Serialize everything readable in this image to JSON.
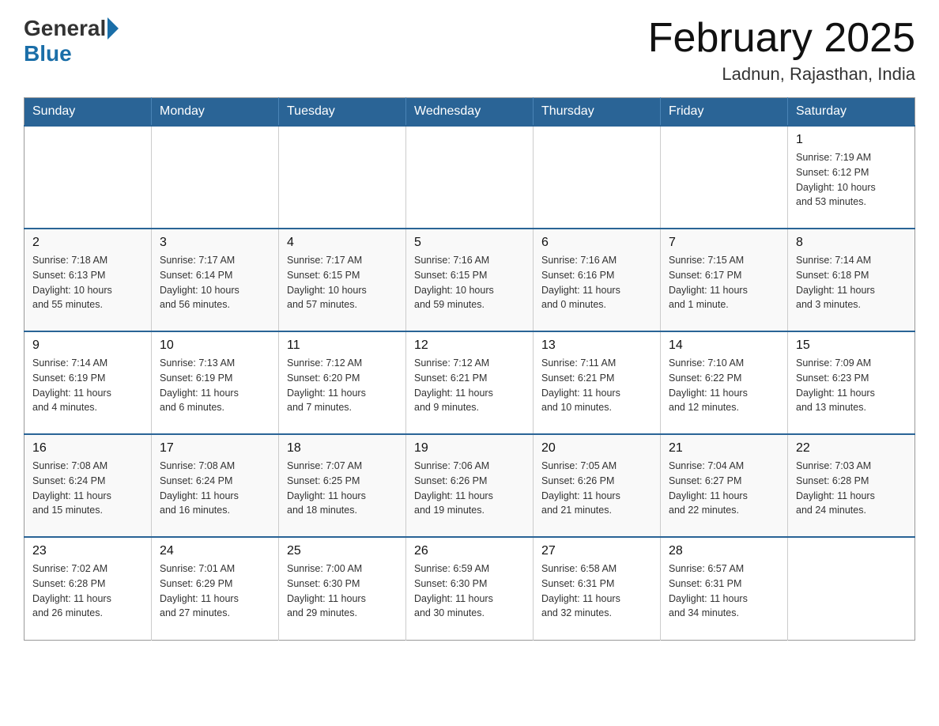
{
  "header": {
    "logo_general": "General",
    "logo_blue": "Blue",
    "month_title": "February 2025",
    "location": "Ladnun, Rajasthan, India"
  },
  "weekdays": [
    "Sunday",
    "Monday",
    "Tuesday",
    "Wednesday",
    "Thursday",
    "Friday",
    "Saturday"
  ],
  "weeks": [
    [
      {
        "day": "",
        "info": ""
      },
      {
        "day": "",
        "info": ""
      },
      {
        "day": "",
        "info": ""
      },
      {
        "day": "",
        "info": ""
      },
      {
        "day": "",
        "info": ""
      },
      {
        "day": "",
        "info": ""
      },
      {
        "day": "1",
        "info": "Sunrise: 7:19 AM\nSunset: 6:12 PM\nDaylight: 10 hours\nand 53 minutes."
      }
    ],
    [
      {
        "day": "2",
        "info": "Sunrise: 7:18 AM\nSunset: 6:13 PM\nDaylight: 10 hours\nand 55 minutes."
      },
      {
        "day": "3",
        "info": "Sunrise: 7:17 AM\nSunset: 6:14 PM\nDaylight: 10 hours\nand 56 minutes."
      },
      {
        "day": "4",
        "info": "Sunrise: 7:17 AM\nSunset: 6:15 PM\nDaylight: 10 hours\nand 57 minutes."
      },
      {
        "day": "5",
        "info": "Sunrise: 7:16 AM\nSunset: 6:15 PM\nDaylight: 10 hours\nand 59 minutes."
      },
      {
        "day": "6",
        "info": "Sunrise: 7:16 AM\nSunset: 6:16 PM\nDaylight: 11 hours\nand 0 minutes."
      },
      {
        "day": "7",
        "info": "Sunrise: 7:15 AM\nSunset: 6:17 PM\nDaylight: 11 hours\nand 1 minute."
      },
      {
        "day": "8",
        "info": "Sunrise: 7:14 AM\nSunset: 6:18 PM\nDaylight: 11 hours\nand 3 minutes."
      }
    ],
    [
      {
        "day": "9",
        "info": "Sunrise: 7:14 AM\nSunset: 6:19 PM\nDaylight: 11 hours\nand 4 minutes."
      },
      {
        "day": "10",
        "info": "Sunrise: 7:13 AM\nSunset: 6:19 PM\nDaylight: 11 hours\nand 6 minutes."
      },
      {
        "day": "11",
        "info": "Sunrise: 7:12 AM\nSunset: 6:20 PM\nDaylight: 11 hours\nand 7 minutes."
      },
      {
        "day": "12",
        "info": "Sunrise: 7:12 AM\nSunset: 6:21 PM\nDaylight: 11 hours\nand 9 minutes."
      },
      {
        "day": "13",
        "info": "Sunrise: 7:11 AM\nSunset: 6:21 PM\nDaylight: 11 hours\nand 10 minutes."
      },
      {
        "day": "14",
        "info": "Sunrise: 7:10 AM\nSunset: 6:22 PM\nDaylight: 11 hours\nand 12 minutes."
      },
      {
        "day": "15",
        "info": "Sunrise: 7:09 AM\nSunset: 6:23 PM\nDaylight: 11 hours\nand 13 minutes."
      }
    ],
    [
      {
        "day": "16",
        "info": "Sunrise: 7:08 AM\nSunset: 6:24 PM\nDaylight: 11 hours\nand 15 minutes."
      },
      {
        "day": "17",
        "info": "Sunrise: 7:08 AM\nSunset: 6:24 PM\nDaylight: 11 hours\nand 16 minutes."
      },
      {
        "day": "18",
        "info": "Sunrise: 7:07 AM\nSunset: 6:25 PM\nDaylight: 11 hours\nand 18 minutes."
      },
      {
        "day": "19",
        "info": "Sunrise: 7:06 AM\nSunset: 6:26 PM\nDaylight: 11 hours\nand 19 minutes."
      },
      {
        "day": "20",
        "info": "Sunrise: 7:05 AM\nSunset: 6:26 PM\nDaylight: 11 hours\nand 21 minutes."
      },
      {
        "day": "21",
        "info": "Sunrise: 7:04 AM\nSunset: 6:27 PM\nDaylight: 11 hours\nand 22 minutes."
      },
      {
        "day": "22",
        "info": "Sunrise: 7:03 AM\nSunset: 6:28 PM\nDaylight: 11 hours\nand 24 minutes."
      }
    ],
    [
      {
        "day": "23",
        "info": "Sunrise: 7:02 AM\nSunset: 6:28 PM\nDaylight: 11 hours\nand 26 minutes."
      },
      {
        "day": "24",
        "info": "Sunrise: 7:01 AM\nSunset: 6:29 PM\nDaylight: 11 hours\nand 27 minutes."
      },
      {
        "day": "25",
        "info": "Sunrise: 7:00 AM\nSunset: 6:30 PM\nDaylight: 11 hours\nand 29 minutes."
      },
      {
        "day": "26",
        "info": "Sunrise: 6:59 AM\nSunset: 6:30 PM\nDaylight: 11 hours\nand 30 minutes."
      },
      {
        "day": "27",
        "info": "Sunrise: 6:58 AM\nSunset: 6:31 PM\nDaylight: 11 hours\nand 32 minutes."
      },
      {
        "day": "28",
        "info": "Sunrise: 6:57 AM\nSunset: 6:31 PM\nDaylight: 11 hours\nand 34 minutes."
      },
      {
        "day": "",
        "info": ""
      }
    ]
  ]
}
